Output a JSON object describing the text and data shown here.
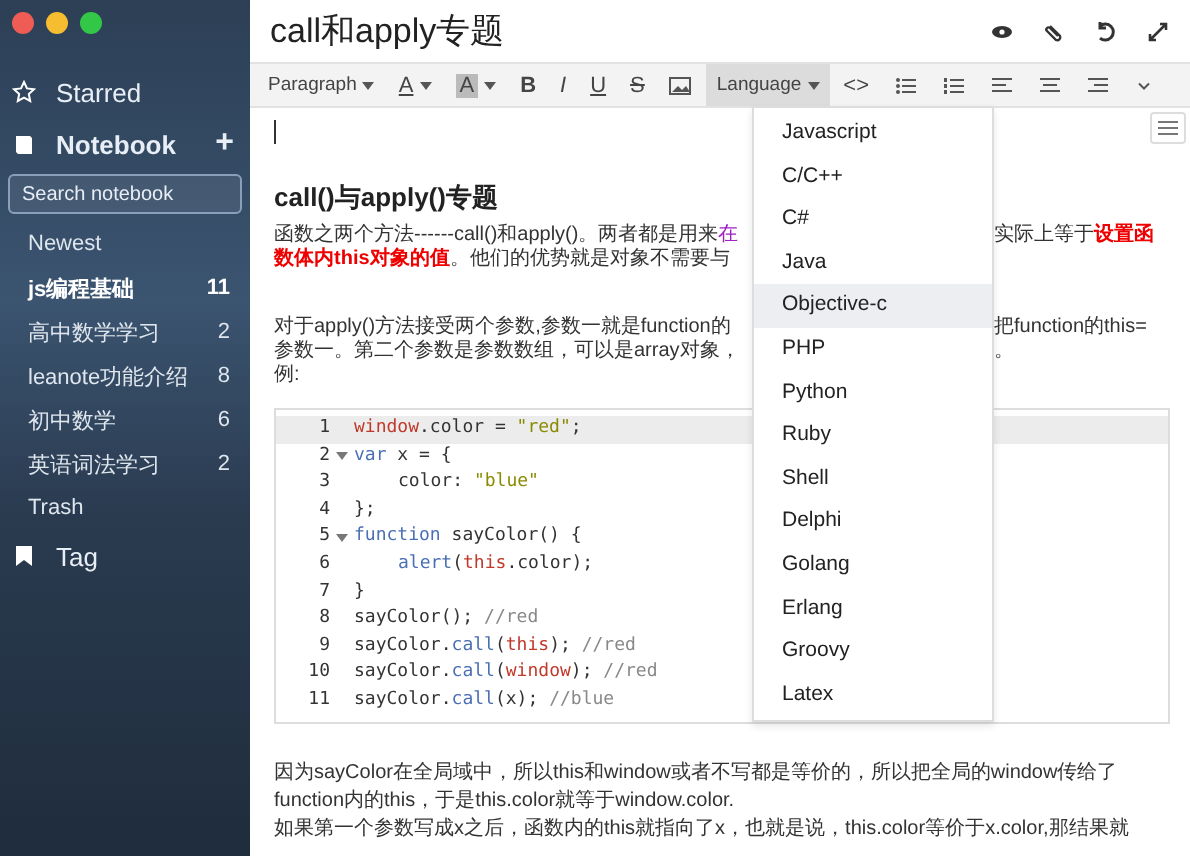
{
  "sidebar": {
    "starred": "Starred",
    "notebook": {
      "label": "Notebook",
      "add": "+"
    },
    "search": {
      "placeholder": "Search notebook"
    },
    "items": [
      {
        "label": "Newest",
        "selected": false
      },
      {
        "label": "js编程基础",
        "count": "11",
        "selected": true
      },
      {
        "label": "高中数学学习",
        "count": "2",
        "selected": false
      },
      {
        "label": "leanote功能介绍",
        "count": "8",
        "selected": false
      },
      {
        "label": "初中数学",
        "count": "6",
        "selected": false
      },
      {
        "label": "英语词法学习",
        "count": "2",
        "selected": false
      },
      {
        "label": "Trash",
        "selected": false
      }
    ],
    "tag": "Tag"
  },
  "note": {
    "title": "call和apply专题",
    "toolbar": [
      {
        "kind": "dropdown",
        "label": "Paragraph",
        "active": false
      },
      {
        "kind": "color",
        "label": "A",
        "active": false
      },
      {
        "kind": "highlight",
        "label": "A",
        "active": false
      },
      {
        "kind": "bold",
        "label": "B",
        "active": false
      },
      {
        "kind": "italic",
        "label": "I",
        "active": false
      },
      {
        "kind": "underline",
        "label": "U",
        "active": false
      },
      {
        "kind": "strike",
        "label": "S",
        "active": false
      },
      {
        "kind": "image",
        "active": false
      },
      {
        "kind": "dropdown",
        "label": "Language",
        "active": true
      },
      {
        "kind": "text",
        "label": "<>",
        "active": false
      },
      {
        "kind": "bullets",
        "active": false
      },
      {
        "kind": "numbers",
        "active": false
      },
      {
        "kind": "align-left",
        "active": false
      },
      {
        "kind": "align-center",
        "active": false
      },
      {
        "kind": "align-right",
        "active": false
      },
      {
        "kind": "more",
        "active": false
      }
    ],
    "heading": "call()与apply()专题",
    "paragraphs": [
      {
        "lines": [
          {
            "left": [
              {
                "kind": "plain",
                "text": "函数之两个方法------call()和apply()。两者都是用来"
              },
              {
                "kind": "link",
                "text": "在"
              }
            ],
            "right": [
              {
                "kind": "plain",
                "text": "实际上等于"
              },
              {
                "kind": "highlight",
                "text": "设置函"
              }
            ]
          },
          {
            "left": [
              {
                "kind": "highlight",
                "text": "数体内this对象的值"
              },
              {
                "kind": "plain",
                "text": "。他们的优势就是对象不需要与"
              }
            ]
          }
        ]
      },
      {
        "lines": [
          {
            "left": [
              {
                "kind": "plain",
                "text": "对于apply()方法接受两个参数,参数一就是function的"
              }
            ],
            "right": [
              {
                "kind": "plain",
                "text": "把function的this="
              }
            ]
          },
          {
            "left": [
              {
                "kind": "plain",
                "text": "参数一。第二个参数是参数数组，可以是array对象，"
              }
            ],
            "right": [
              {
                "kind": "plain",
                "text": "。"
              }
            ]
          },
          {
            "left": [
              {
                "kind": "plain",
                "text": "例:"
              }
            ]
          }
        ]
      }
    ],
    "code": [
      {
        "number": "1",
        "fold": false,
        "indented": false,
        "active": true,
        "tokens": [
          {
            "kind": "var",
            "text": "window"
          },
          {
            "kind": "plain",
            "text": ".color = "
          },
          {
            "kind": "str",
            "text": "\"red\""
          },
          {
            "kind": "plain",
            "text": ";"
          }
        ]
      },
      {
        "number": "2",
        "fold": true,
        "indented": false,
        "active": false,
        "tokens": [
          {
            "kind": "kw",
            "text": "var"
          },
          {
            "kind": "plain",
            "text": " x = {"
          }
        ]
      },
      {
        "number": "3",
        "fold": false,
        "indented": true,
        "active": false,
        "tokens": [
          {
            "kind": "plain",
            "text": "color: "
          },
          {
            "kind": "str",
            "text": "\"blue\""
          }
        ]
      },
      {
        "number": "4",
        "fold": false,
        "indented": false,
        "active": false,
        "tokens": [
          {
            "kind": "plain",
            "text": "};"
          }
        ]
      },
      {
        "number": "5",
        "fold": true,
        "indented": false,
        "active": false,
        "tokens": [
          {
            "kind": "kw",
            "text": "function"
          },
          {
            "kind": "plain",
            "text": " sayColor() {"
          }
        ]
      },
      {
        "number": "6",
        "fold": false,
        "indented": true,
        "active": false,
        "tokens": [
          {
            "kind": "fn",
            "text": "alert"
          },
          {
            "kind": "plain",
            "text": "("
          },
          {
            "kind": "var",
            "text": "this"
          },
          {
            "kind": "plain",
            "text": ".color);"
          }
        ]
      },
      {
        "number": "7",
        "fold": false,
        "indented": false,
        "active": false,
        "tokens": [
          {
            "kind": "plain",
            "text": "}"
          }
        ]
      },
      {
        "number": "8",
        "fold": false,
        "indented": false,
        "active": false,
        "tokens": [
          {
            "kind": "plain",
            "text": "sayColor(); "
          },
          {
            "kind": "com",
            "text": "//red"
          }
        ]
      },
      {
        "number": "9",
        "fold": false,
        "indented": false,
        "active": false,
        "tokens": [
          {
            "kind": "plain",
            "text": "sayColor."
          },
          {
            "kind": "fn",
            "text": "call"
          },
          {
            "kind": "plain",
            "text": "("
          },
          {
            "kind": "var",
            "text": "this"
          },
          {
            "kind": "plain",
            "text": "); "
          },
          {
            "kind": "com",
            "text": "//red"
          }
        ]
      },
      {
        "number": "10",
        "fold": false,
        "indented": false,
        "active": false,
        "tokens": [
          {
            "kind": "plain",
            "text": "sayColor."
          },
          {
            "kind": "fn",
            "text": "call"
          },
          {
            "kind": "plain",
            "text": "("
          },
          {
            "kind": "var",
            "text": "window"
          },
          {
            "kind": "plain",
            "text": "); "
          },
          {
            "kind": "com",
            "text": "//red"
          }
        ]
      },
      {
        "number": "11",
        "fold": false,
        "indented": false,
        "active": false,
        "tokens": [
          {
            "kind": "plain",
            "text": "sayColor."
          },
          {
            "kind": "fn",
            "text": "call"
          },
          {
            "kind": "plain",
            "text": "(x); "
          },
          {
            "kind": "com",
            "text": "//blue"
          }
        ]
      }
    ],
    "after": [
      "因为sayColor在全局域中，所以this和window或者不写都是等价的，所以把全局的window传给了",
      "function内的this，于是this.color就等于window.color.",
      "如果第一个参数写成x之后，函数内的this就指向了x，也就是说，this.color等价于x.color,那结果就"
    ],
    "languages": [
      {
        "label": "Javascript",
        "selected": false
      },
      {
        "label": "C/C++",
        "selected": false
      },
      {
        "label": "C#",
        "selected": false
      },
      {
        "label": "Java",
        "selected": false
      },
      {
        "label": "Objective-c",
        "selected": true
      },
      {
        "label": "PHP",
        "selected": false
      },
      {
        "label": "Python",
        "selected": false
      },
      {
        "label": "Ruby",
        "selected": false
      },
      {
        "label": "Shell",
        "selected": false
      },
      {
        "label": "Delphi",
        "selected": false
      },
      {
        "label": "Golang",
        "selected": false
      },
      {
        "label": "Erlang",
        "selected": false
      },
      {
        "label": "Groovy",
        "selected": false
      },
      {
        "label": "Latex",
        "selected": false
      }
    ]
  }
}
